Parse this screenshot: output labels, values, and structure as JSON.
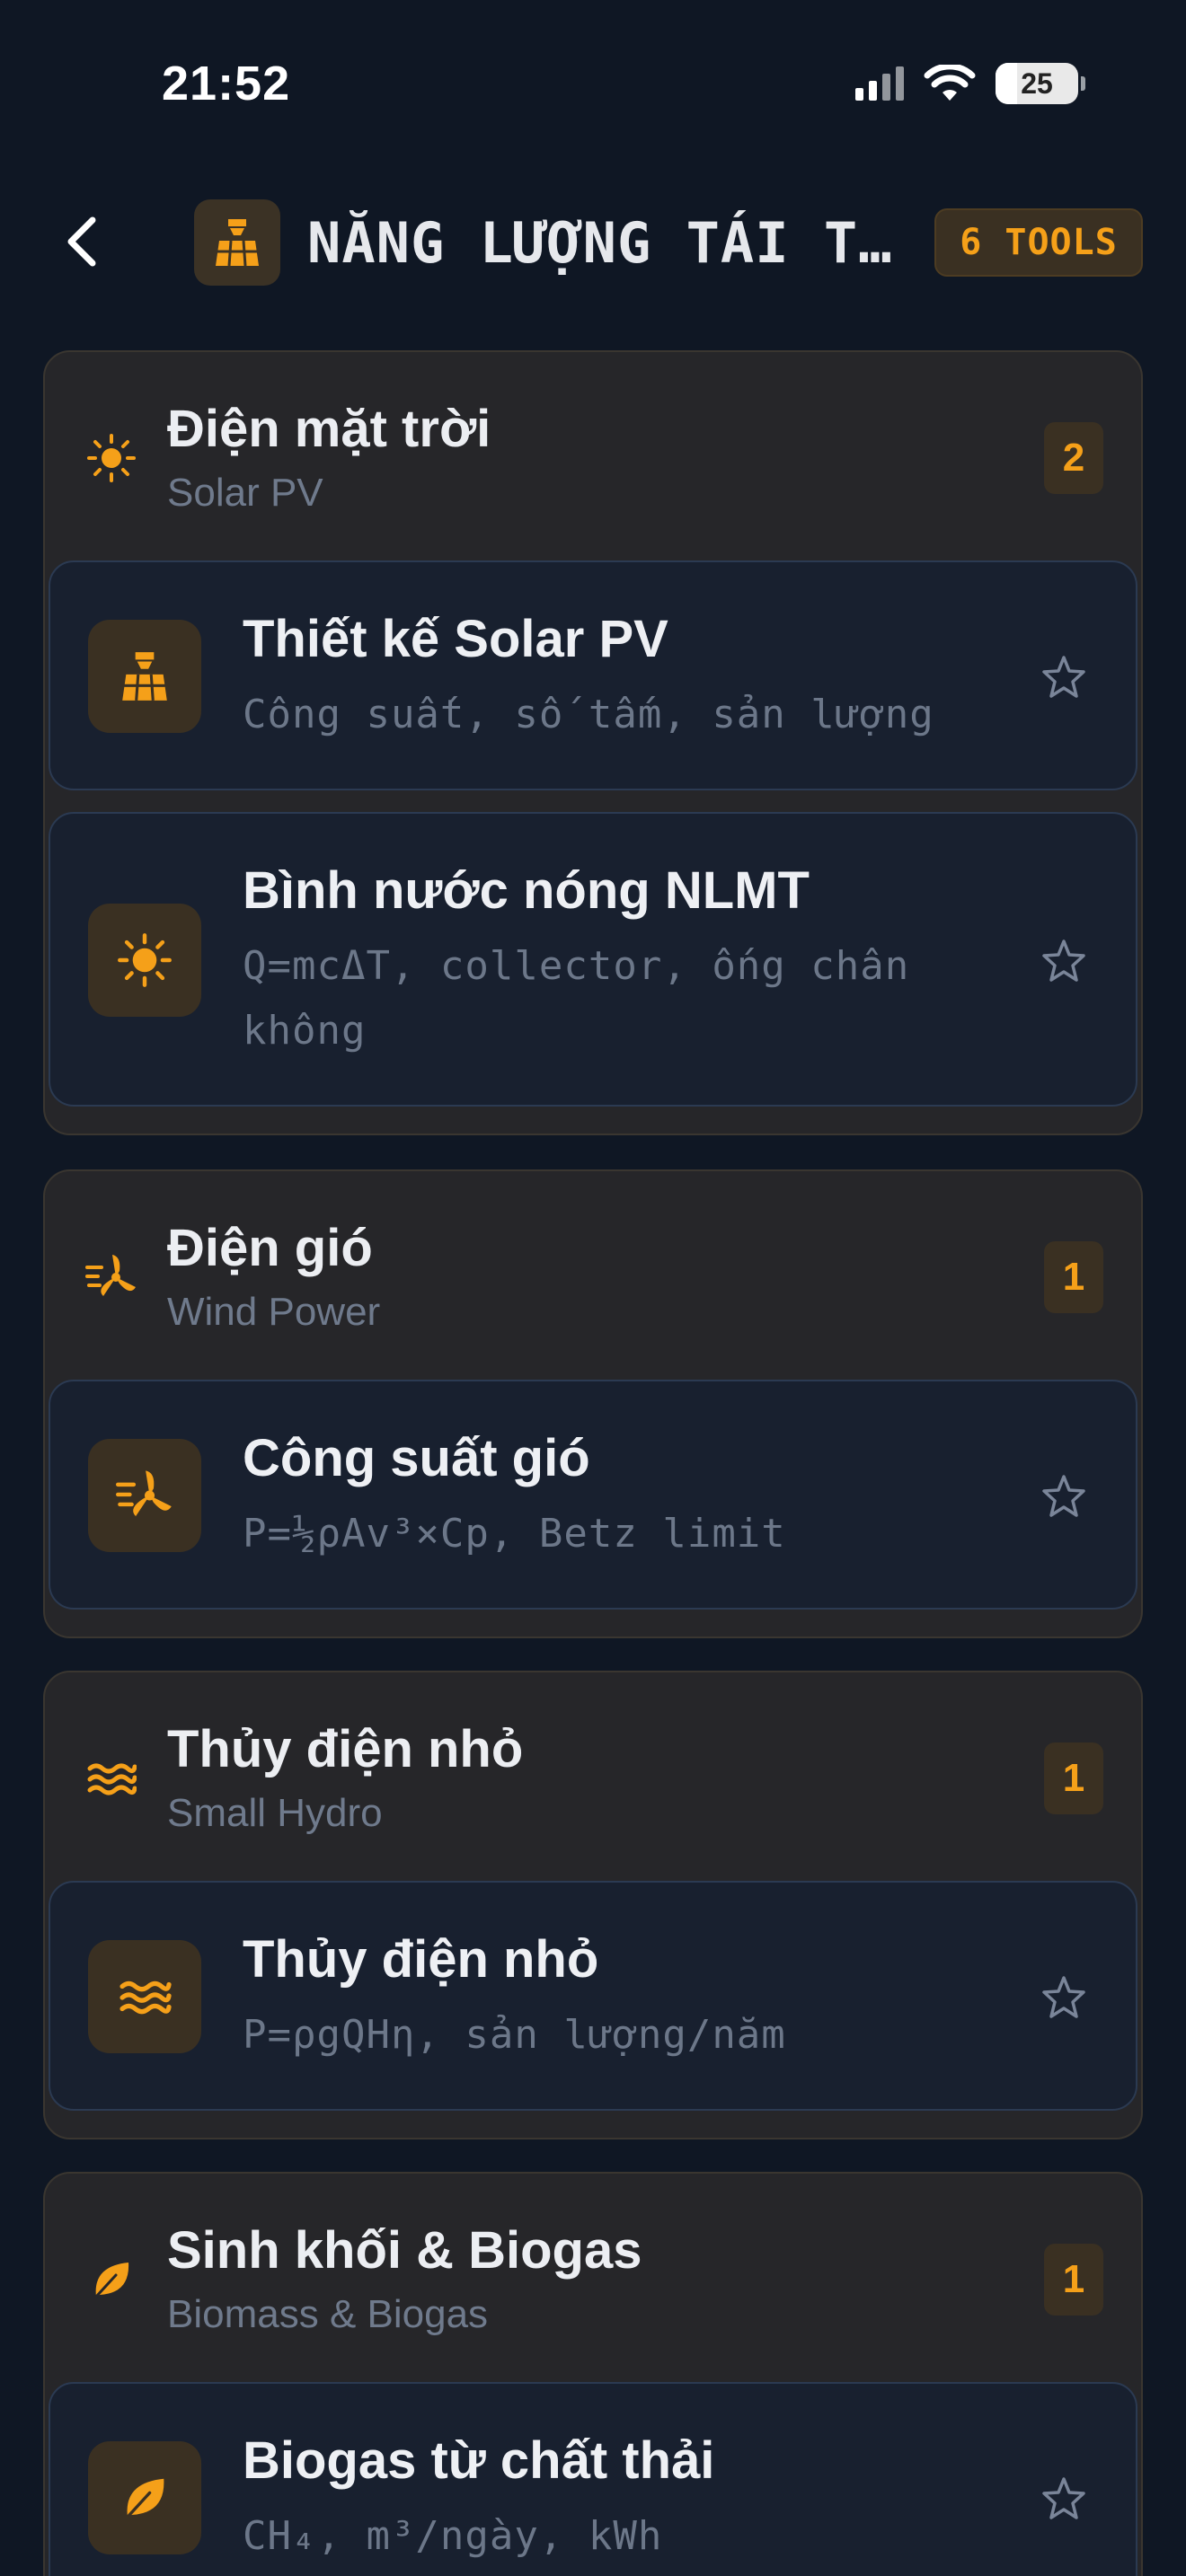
{
  "status_bar": {
    "time": "21:52",
    "battery": "25"
  },
  "header": {
    "title": "NĂNG LƯỢNG TÁI T…",
    "tools_badge": "6 TOOLS",
    "icon": "solar-panel-icon"
  },
  "accent_color": "#f5a019",
  "sections": [
    {
      "title": "Điện mặt trời",
      "subtitle": "Solar PV",
      "count": "2",
      "icon": "sun-icon",
      "tools": [
        {
          "title": "Thiết kế Solar PV",
          "desc": "Công suất, số tấm, sản lượng",
          "icon": "solar-panel-icon"
        },
        {
          "title": "Bình nước nóng NLMT",
          "desc": "Q=mcΔT, collector, ống chân không",
          "icon": "sun-icon"
        }
      ]
    },
    {
      "title": "Điện gió",
      "subtitle": "Wind Power",
      "count": "1",
      "icon": "wind-turbine-icon",
      "tools": [
        {
          "title": "Công suất gió",
          "desc": "P=½ρAv³×Cp, Betz limit",
          "icon": "wind-turbine-icon"
        }
      ]
    },
    {
      "title": "Thủy điện nhỏ",
      "subtitle": "Small Hydro",
      "count": "1",
      "icon": "water-waves-icon",
      "tools": [
        {
          "title": "Thủy điện nhỏ",
          "desc": "P=ρgQHη, sản lượng/năm",
          "icon": "water-waves-icon"
        }
      ]
    },
    {
      "title": "Sinh khối & Biogas",
      "subtitle": "Biomass & Biogas",
      "count": "1",
      "icon": "leaf-icon",
      "tools": [
        {
          "title": "Biogas từ chất thải",
          "desc": "CH₄, m³/ngày, kWh",
          "icon": "leaf-icon"
        }
      ]
    }
  ]
}
